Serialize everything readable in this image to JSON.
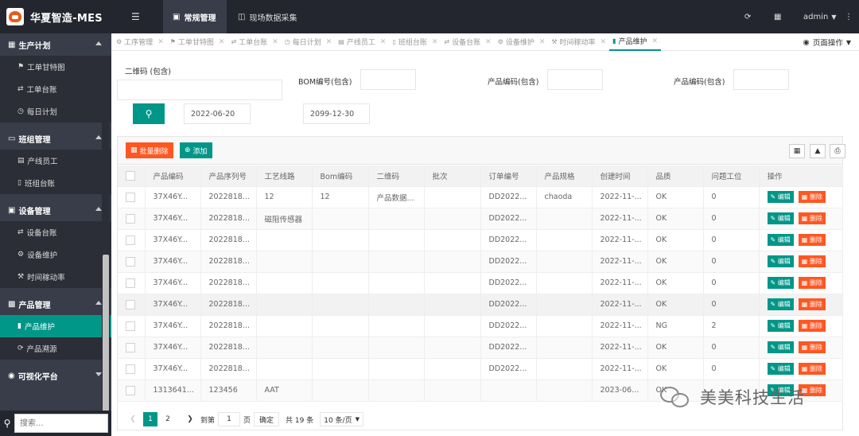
{
  "app": {
    "title": "华夏智造-MES"
  },
  "topnav": {
    "tabs": [
      {
        "label": "常规管理",
        "active": true
      },
      {
        "label": "现场数据采集",
        "active": false
      }
    ],
    "user": "admin"
  },
  "sidebar": {
    "groups": [
      {
        "label": "生产计划",
        "icon": "calendar-icon",
        "items": [
          {
            "label": "工单甘特图",
            "icon": "flag-icon"
          },
          {
            "label": "工单台账",
            "icon": "exchange-icon"
          },
          {
            "label": "每日计划",
            "icon": "clock-icon"
          }
        ]
      },
      {
        "label": "班组管理",
        "icon": "monitor-icon",
        "items": [
          {
            "label": "产线员工",
            "icon": "id-card-icon"
          },
          {
            "label": "班组台账",
            "icon": "mobile-icon"
          }
        ]
      },
      {
        "label": "设备管理",
        "icon": "device-icon",
        "items": [
          {
            "label": "设备台账",
            "icon": "exchange-icon"
          },
          {
            "label": "设备维护",
            "icon": "gear-icon"
          },
          {
            "label": "时间稼动率",
            "icon": "wrench-icon"
          }
        ]
      },
      {
        "label": "产品管理",
        "icon": "chart-icon",
        "items": [
          {
            "label": "产品维护",
            "icon": "bookmark-icon",
            "active": true
          },
          {
            "label": "产品溯源",
            "icon": "refresh-icon"
          }
        ]
      },
      {
        "label": "可视化平台",
        "icon": "camera-icon",
        "items": []
      }
    ],
    "search_placeholder": "搜索..."
  },
  "page_tabs": [
    {
      "label": "工序管理",
      "icon": "gear-icon"
    },
    {
      "label": "工单甘特图",
      "icon": "flag-icon"
    },
    {
      "label": "工单台账",
      "icon": "exchange-icon"
    },
    {
      "label": "每日计划",
      "icon": "clock-icon"
    },
    {
      "label": "产线员工",
      "icon": "id-card-icon"
    },
    {
      "label": "班组台账",
      "icon": "mobile-icon"
    },
    {
      "label": "设备台账",
      "icon": "exchange-icon"
    },
    {
      "label": "设备维护",
      "icon": "gear-icon"
    },
    {
      "label": "时间稼动率",
      "icon": "wrench-icon"
    },
    {
      "label": "产品维护",
      "icon": "bookmark-icon",
      "active": true
    }
  ],
  "page_ops_label": "页面操作",
  "filters": {
    "qrcode_label": "二维码 (包含)",
    "bom_label": "BOM编号(包含)",
    "product_serial_label": "产品编码(包含)",
    "product_code_label": "产品编码(包含)",
    "date_start": "2022-06-20",
    "date_end": "2099-12-30"
  },
  "toolbar": {
    "batch_delete": "批量删除",
    "add": "添加"
  },
  "table": {
    "columns": [
      "产品编码",
      "产品序列号",
      "工艺线路",
      "Bom编码",
      "二维码",
      "批次",
      "订单编号",
      "产品规格",
      "创建时间",
      "品质",
      "问题工位",
      "操作"
    ],
    "rows": [
      [
        "37X46Y...",
        "2022818...",
        "12",
        "12",
        "产品数据...",
        "",
        "DD2022...",
        "chaoda",
        "2022-11-...",
        "OK",
        "0"
      ],
      [
        "37X46Y...",
        "2022818...",
        "磁阻传感器",
        "",
        "",
        "",
        "DD2022...",
        "",
        "2022-11-...",
        "OK",
        "0"
      ],
      [
        "37X46Y...",
        "2022818...",
        "",
        "",
        "",
        "",
        "DD2022...",
        "",
        "2022-11-...",
        "OK",
        "0"
      ],
      [
        "37X46Y...",
        "2022818...",
        "",
        "",
        "",
        "",
        "DD2022...",
        "",
        "2022-11-...",
        "OK",
        "0"
      ],
      [
        "37X46Y...",
        "2022818...",
        "",
        "",
        "",
        "",
        "DD2022...",
        "",
        "2022-11-...",
        "OK",
        "0"
      ],
      [
        "37X46Y...",
        "2022818...",
        "",
        "",
        "",
        "",
        "DD2022...",
        "",
        "2022-11-...",
        "OK",
        "0"
      ],
      [
        "37X46Y...",
        "2022818...",
        "",
        "",
        "",
        "",
        "DD2022...",
        "",
        "2022-11-...",
        "NG",
        "2"
      ],
      [
        "37X46Y...",
        "2022818...",
        "",
        "",
        "",
        "",
        "DD2022...",
        "",
        "2022-11-...",
        "OK",
        "0"
      ],
      [
        "37X46Y...",
        "2022818...",
        "",
        "",
        "",
        "",
        "DD2022...",
        "",
        "2022-11-...",
        "OK",
        "0"
      ],
      [
        "1313641...",
        "123456",
        "AAT",
        "",
        "",
        "",
        "",
        "",
        "2023-06...",
        "OK",
        ""
      ]
    ],
    "edit_label": "编辑",
    "delete_label": "删除"
  },
  "pager": {
    "pages": [
      "1",
      "2"
    ],
    "goto_prefix": "到第",
    "goto_value": "1",
    "page_unit": "页",
    "confirm": "确定",
    "total": "共 19 条",
    "page_size": "10 条/页"
  },
  "watermark": {
    "text": "美美科技生活"
  },
  "colors": {
    "primary": "#009688",
    "danger": "#ff5722",
    "sidebar": "#393d49",
    "topbar": "#23262e"
  }
}
